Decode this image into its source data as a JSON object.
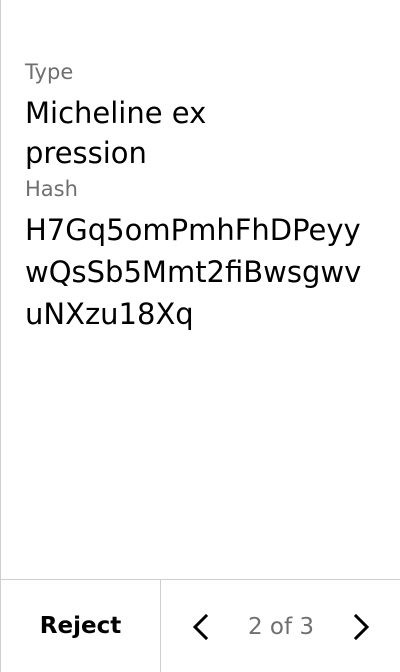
{
  "details": {
    "type_label": "Type",
    "type_value": "Micheline expression",
    "hash_label": "Hash",
    "hash_value": "H7Gq5omPmhFhDPeyywQsSb5Mmt2fiBwsgwvuNXzu18Xq"
  },
  "footer": {
    "reject_label": "Reject",
    "page_indicator": "2 of 3"
  },
  "icons": {
    "previous": "chevron-left-icon",
    "next": "chevron-right-icon"
  },
  "colors": {
    "background": "#ffffff",
    "text": "#000000",
    "muted_text": "#6f6f6f",
    "divider": "#cfcfcf"
  }
}
